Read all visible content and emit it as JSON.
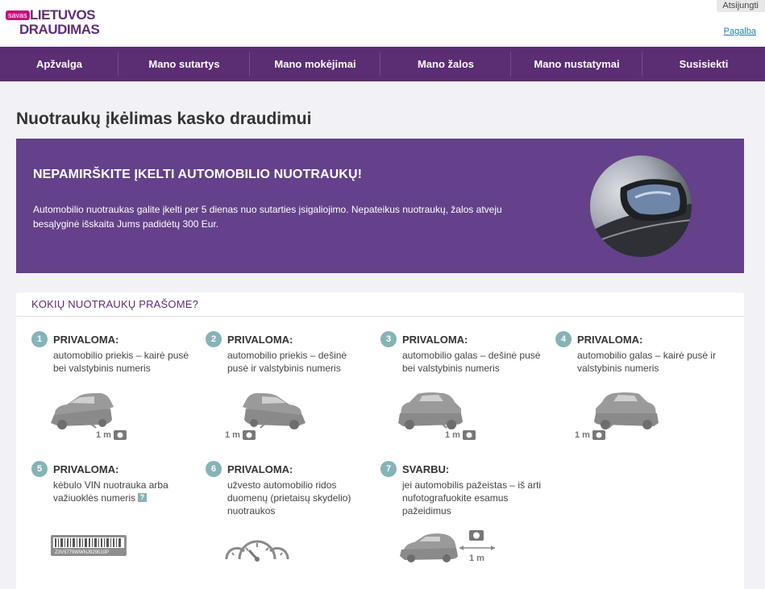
{
  "header": {
    "logo_badge": "savas",
    "logo_line1": "LIETUVOS",
    "logo_line2": "DRAUDIMAS",
    "logout_label": "Atsijungti",
    "help_label": "Pagalba"
  },
  "nav": {
    "items": [
      {
        "label": "Apžvalga"
      },
      {
        "label": "Mano sutartys"
      },
      {
        "label": "Mano mokėjimai"
      },
      {
        "label": "Mano žalos"
      },
      {
        "label": "Mano nustatymai"
      },
      {
        "label": "Susisiekti"
      }
    ]
  },
  "page": {
    "title": "Nuotraukų įkėlimas kasko draudimui"
  },
  "banner": {
    "headline": "NEPAMIRŠKITE ĮKELTI AUTOMOBILIO NUOTRAUKŲ!",
    "description": "Automobilio nuotraukas galite įkelti per 5 dienas nuo sutarties įsigaliojimo. Nepateikus nuotraukų, žalos atveju besąlyginė išskaita Jums padidėtų 300 Eur."
  },
  "card": {
    "title": "KOKIŲ NUOTRAUKŲ PRAŠOME?",
    "distance_label": "1 m",
    "vin_sample": "Z3V5779WWNJ929010P",
    "requirements": [
      {
        "number": "1",
        "label": "PRIVALOMA:",
        "text": "automobilio priekis – kairė pusė bei valstybinis numeris",
        "icon": "car-front-left-icon"
      },
      {
        "number": "2",
        "label": "PRIVALOMA:",
        "text": "automobilio priekis – dešinė pusė ir valstybinis numeris",
        "icon": "car-front-right-icon"
      },
      {
        "number": "3",
        "label": "PRIVALOMA:",
        "text": "automobilio galas – dešinė pusė bei valstybinis numeris",
        "icon": "car-rear-right-icon"
      },
      {
        "number": "4",
        "label": "PRIVALOMA:",
        "text": "automobilio galas – kairė pusė ir valstybinis numeris",
        "icon": "car-rear-left-icon"
      },
      {
        "number": "5",
        "label": "PRIVALOMA:",
        "text": "kėbulo VIN nuotrauka arba važiuoklės numeris",
        "icon": "vin-barcode-icon",
        "help": "?"
      },
      {
        "number": "6",
        "label": "PRIVALOMA:",
        "text": "užvesto automobilio ridos duomenų (prietaisų skydelio) nuotraukos",
        "icon": "dashboard-gauges-icon"
      },
      {
        "number": "7",
        "label": "SVARBU:",
        "text": "jei automobilis pažeistas – iš arti nufotografuokite esamus pažeidimus",
        "icon": "car-damage-closeup-icon"
      }
    ]
  }
}
